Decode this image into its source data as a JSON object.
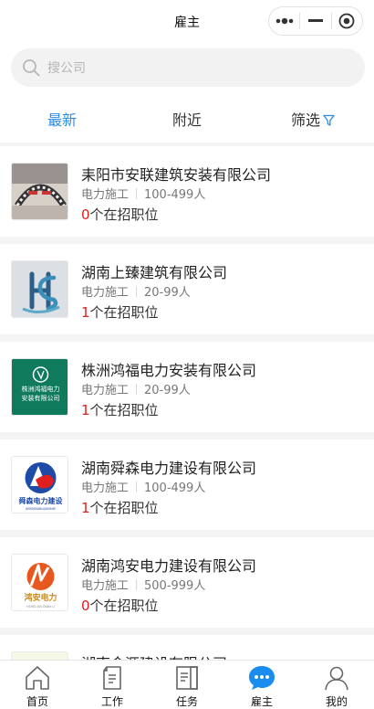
{
  "header": {
    "title": "雇主"
  },
  "search": {
    "placeholder": "搜公司"
  },
  "tabs": [
    {
      "label": "最新",
      "active": true
    },
    {
      "label": "附近",
      "active": false
    },
    {
      "label": "筛选",
      "active": false,
      "icon": "filter-icon"
    }
  ],
  "companies": [
    {
      "name": "耒阳市安联建筑安装有限公司",
      "type": "电力施工",
      "size": "100-499人",
      "jobs": "0",
      "jobs_suffix": "个在招职位"
    },
    {
      "name": "湖南上臻建筑有限公司",
      "type": "电力施工",
      "size": "20-99人",
      "jobs": "1",
      "jobs_suffix": "个在招职位"
    },
    {
      "name": "株洲鸿福电力安装有限公司",
      "type": "电力施工",
      "size": "20-99人",
      "jobs": "1",
      "jobs_suffix": "个在招职位",
      "logo_text": "株洲鸿福电力安装有限公司"
    },
    {
      "name": "湖南舜森电力建设有限公司",
      "type": "电力施工",
      "size": "100-499人",
      "jobs": "1",
      "jobs_suffix": "个在招职位",
      "logo_text": "舜森电力建设",
      "logo_sub": "AISENDIANLIJIANSHE"
    },
    {
      "name": "湖南鸿安电力建设有限公司",
      "type": "电力施工",
      "size": "500-999人",
      "jobs": "0",
      "jobs_suffix": "个在招职位",
      "logo_text": "鸿安电力",
      "logo_sub": "HONG AN DIAN LI"
    },
    {
      "name": "湖南金源建设有限公司",
      "type": "",
      "size": "",
      "jobs": "",
      "jobs_suffix": ""
    }
  ],
  "tabbar": [
    {
      "label": "首页",
      "icon": "home-icon",
      "active": false
    },
    {
      "label": "工作",
      "icon": "work-icon",
      "active": false
    },
    {
      "label": "任务",
      "icon": "task-icon",
      "active": false
    },
    {
      "label": "雇主",
      "icon": "employer-chat-icon",
      "active": true
    },
    {
      "label": "我的",
      "icon": "profile-icon",
      "active": false
    }
  ],
  "colors": {
    "accent": "#2d8ce8",
    "jobs_count": "#e21b1b",
    "logo_green": "#0f7a5c"
  }
}
